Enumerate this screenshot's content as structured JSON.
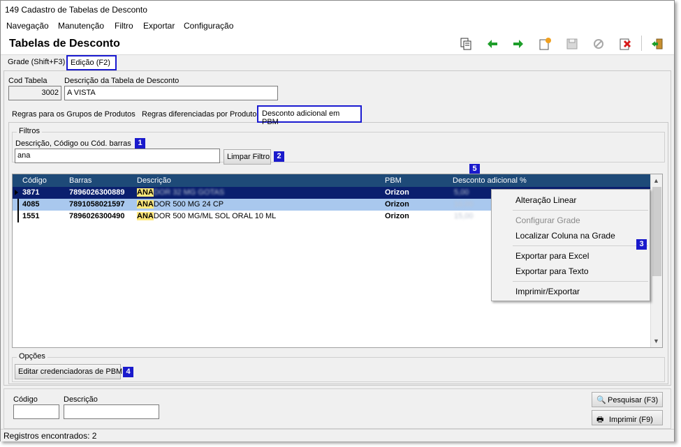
{
  "window": {
    "title": "149 Cadastro de Tabelas de Desconto"
  },
  "menu": [
    "Navegação",
    "Manutenção",
    "Filtro",
    "Exportar",
    "Configuração"
  ],
  "header": {
    "title": "Tabelas de Desconto"
  },
  "toolbar_icons": [
    "copy-icon",
    "arrow-left-icon",
    "arrow-right-icon",
    "new-icon",
    "save-icon",
    "cancel-icon",
    "delete-icon",
    "exit-icon"
  ],
  "main_tabs": [
    "Grade (Shift+F3)",
    "Edição (F2)"
  ],
  "form": {
    "cod_label": "Cod Tabela",
    "cod_value": "3002",
    "desc_label": "Descrição da Tabela de Desconto",
    "desc_value": "A VISTA"
  },
  "sub_tabs": [
    "Regras para os Grupos de Produtos",
    "Regras diferenciadas por Produto",
    "Desconto adicional em PBM"
  ],
  "filtros": {
    "legend": "Filtros",
    "label": "Descrição, Código ou Cód. barras",
    "value": "ana",
    "clear_button": "Limpar Filtro"
  },
  "grid": {
    "columns": [
      "Código",
      "Barras",
      "Descrição",
      "PBM",
      "Desconto adicional %"
    ],
    "rows": [
      {
        "codigo": "3871",
        "barras": "7896026300889",
        "desc_match": "ANA",
        "desc_rest": "DOR 32 MG GOTAS",
        "pbm": "Orizon",
        "desconto": "5,00"
      },
      {
        "codigo": "4085",
        "barras": "7891058021597",
        "desc_match": "ANA",
        "desc_rest": "DOR 500 MG 24 CP",
        "pbm": "Orizon",
        "desconto": "10,00"
      },
      {
        "codigo": "1551",
        "barras": "7896026300490",
        "desc_match": "ANA",
        "desc_rest": "DOR 500 MG/ML SOL ORAL 10 ML",
        "pbm": "Orizon",
        "desconto": "15,00"
      }
    ]
  },
  "context_menu": {
    "items": [
      "Alteração Linear",
      "Configurar Grade",
      "Localizar Coluna na Grade",
      "Exportar para Excel",
      "Exportar para Texto",
      "Imprimir/Exportar"
    ]
  },
  "opcoes": {
    "legend": "Opções",
    "button": "Editar credenciadoras de PBM"
  },
  "badges": [
    "1",
    "2",
    "3",
    "4",
    "5"
  ],
  "bottom": {
    "codigo_label": "Código",
    "descricao_label": "Descrição",
    "pesquisar_button": "Pesquisar (F3)",
    "imprimir_button": "Imprimir (F9)"
  },
  "status": {
    "text": "Registros encontrados: 2"
  },
  "colors": {
    "accent": "#1a1acc",
    "grid_header": "#1e4a78",
    "selected_row": "#0a1f6e",
    "alt_row": "#a9c8ee",
    "match_highlight": "#ffe87a"
  }
}
